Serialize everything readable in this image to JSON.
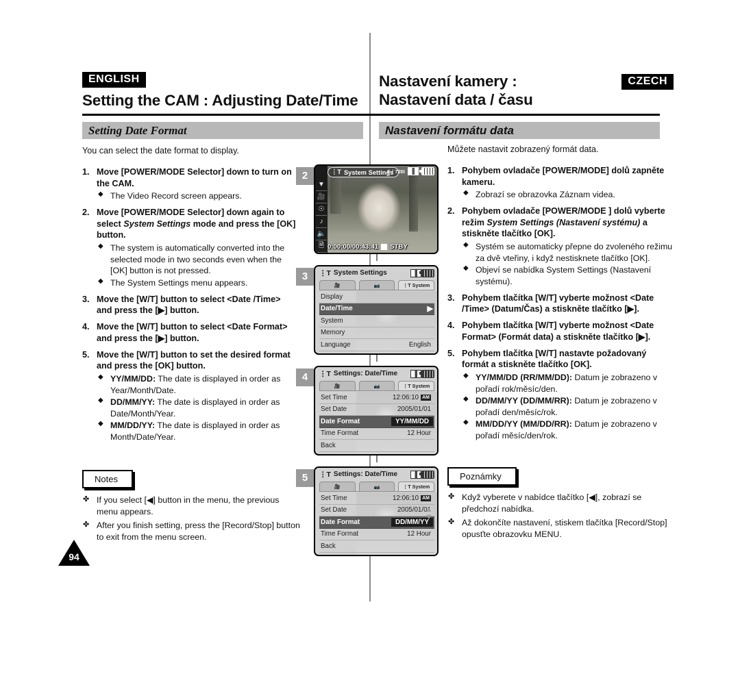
{
  "header": {
    "english_tag": "ENGLISH",
    "english_title": "Setting the CAM : Adjusting Date/Time",
    "czech_tag": "CZECH",
    "czech_title_line1": "Nastavení kamery :",
    "czech_title_line2": "Nastavení data / času"
  },
  "section": {
    "english": "Setting Date Format",
    "czech": "Nastavení formátu data"
  },
  "english": {
    "intro": "You can select the date format to display.",
    "steps": [
      {
        "num": "1.",
        "text_parts": [
          {
            "t": "Move [POWER/MODE Selector] down to turn on the CAM.",
            "style": "bold"
          }
        ],
        "bullets": [
          {
            "text": "The Video Record screen appears."
          }
        ]
      },
      {
        "num": "2.",
        "text_parts": [
          {
            "t": "Move [POWER/MODE Selector] down again to select ",
            "style": "bold"
          },
          {
            "t": "System Settings",
            "style": "bold-italic"
          },
          {
            "t": " mode and press the [OK] button.",
            "style": "bold"
          }
        ],
        "bullets": [
          {
            "text": "The system is automatically converted into the selected mode in two seconds even when the [OK] button is not pressed."
          },
          {
            "text": "The System Settings menu appears."
          }
        ]
      },
      {
        "num": "3.",
        "text_parts": [
          {
            "t": "Move the [W/T] button to select <Date /Time> and press the [▶] button.",
            "style": "bold"
          }
        ],
        "bullets": []
      },
      {
        "num": "4.",
        "text_parts": [
          {
            "t": "Move the [W/T] button to select <Date Format> and press the [▶] button.",
            "style": "bold"
          }
        ],
        "bullets": []
      },
      {
        "num": "5.",
        "text_parts": [
          {
            "t": "Move the [W/T] button to set the desired format and press the [OK] button.",
            "style": "bold"
          }
        ],
        "bullets": [
          {
            "lead": "YY/MM/DD:",
            "text": " The date is displayed in order as Year/Month/Date."
          },
          {
            "lead": "DD/MM/YY:",
            "text": " The date is displayed in order as Date/Month/Year."
          },
          {
            "lead": "MM/DD/YY:",
            "text": " The date is displayed in order as Month/Date/Year."
          }
        ]
      }
    ],
    "notes_label": "Notes",
    "notes": [
      "If you select [◀] button in the menu, the previous menu appears.",
      "After you finish setting, press the [Record/Stop] button to exit from the menu screen."
    ]
  },
  "czech": {
    "intro": "Můžete nastavit zobrazený formát data.",
    "steps": [
      {
        "num": "1.",
        "text_parts": [
          {
            "t": "Pohybem ovladače [POWER/MODE] dolů zapněte kameru.",
            "style": "bold"
          }
        ],
        "bullets": [
          {
            "text": "Zobrazí se obrazovka Záznam videa."
          }
        ]
      },
      {
        "num": "2.",
        "text_parts": [
          {
            "t": "Pohybem ovladače [POWER/MODE ] dolů vyberte režim ",
            "style": "bold"
          },
          {
            "t": "System Settings (Nastavení systému)",
            "style": "bold-italic"
          },
          {
            "t": " a stiskněte tlačítko [OK].",
            "style": "bold"
          }
        ],
        "bullets": [
          {
            "text": "Systém se automaticky přepne do zvoleného režimu za dvě vteřiny, i když nestisknete tlačítko [OK]."
          },
          {
            "text": "Objeví se nabídka System Settings (Nastavení systému)."
          }
        ]
      },
      {
        "num": "3.",
        "text_parts": [
          {
            "t": "Pohybem tlačítka [W/T] vyberte možnost <Date /Time> (Datum/Čas) a stiskněte tlačítko [▶].",
            "style": "bold"
          }
        ],
        "bullets": []
      },
      {
        "num": "4.",
        "text_parts": [
          {
            "t": "Pohybem tlačítka [W/T] vyberte možnost <Date Format> (Formát data) a stiskněte tlačítko [▶].",
            "style": "bold"
          }
        ],
        "bullets": []
      },
      {
        "num": "5.",
        "text_parts": [
          {
            "t": "Pohybem tlačítka [W/T] nastavte požadovaný formát a stiskněte tlačítko [OK].",
            "style": "bold"
          }
        ],
        "bullets": [
          {
            "lead": "YY/MM/DD (RR/MM/DD):",
            "text": " Datum je zobrazeno v pořadí rok/měsíc/den."
          },
          {
            "lead": "DD/MM/YY (DD/MM/RR):",
            "text": " Datum je zobrazeno v pořadí den/měsíc/rok."
          },
          {
            "lead": "MM/DD/YY (MM/DD/RR):",
            "text": " Datum je zobrazeno v pořadí měsíc/den/rok."
          }
        ]
      }
    ],
    "notes_label": "Poznámky",
    "notes": [
      "Když vyberete v nabídce tlačítko [◀], zobrazí se předchozí nabídka.",
      "Až dokončíte nastavení, stiskem tlačítka [Record/Stop] opusťte obrazovku MENU."
    ]
  },
  "screens": {
    "shot1": {
      "badge": "2",
      "osd_mode_label": "System Settings",
      "format_label": "F / 720i",
      "timecode": "0:00:00/00:43:41",
      "status": "STBY",
      "side_icons": [
        "chevron-down-icon",
        "video-camera-icon",
        "photo-camera-icon",
        "music-note-icon",
        "microphone-icon",
        "document-icon"
      ]
    },
    "shot2": {
      "badge": "3",
      "title": "System Settings",
      "tabs": [
        {
          "label": "🎥",
          "name": "video-tab",
          "active": false
        },
        {
          "label": "📷",
          "name": "photo-tab",
          "active": false
        },
        {
          "label": "System",
          "name": "system-tab",
          "active": true
        }
      ],
      "rows": [
        {
          "label": "Display",
          "value": "",
          "selected": false
        },
        {
          "label": "Date/Time",
          "value": "",
          "selected": true
        },
        {
          "label": "System",
          "value": "",
          "selected": false
        },
        {
          "label": "Memory",
          "value": "",
          "selected": false
        },
        {
          "label": "Language",
          "value": "English",
          "selected": false
        }
      ]
    },
    "shot3": {
      "badge": "4",
      "title": "Settings: Date/Time",
      "tabs": [
        {
          "label": "🎥",
          "name": "video-tab",
          "active": false
        },
        {
          "label": "📷",
          "name": "photo-tab",
          "active": false
        },
        {
          "label": "System",
          "name": "system-tab",
          "active": true
        }
      ],
      "rows": [
        {
          "label": "Set Time",
          "value": "12:06:10",
          "ampm": "AM",
          "selected": false
        },
        {
          "label": "Set Date",
          "value": "2005/01/01",
          "selected": false
        },
        {
          "label": "Date Format",
          "value": "YY/MM/DD",
          "selected": true,
          "highlight": true
        },
        {
          "label": "Time Format",
          "value": "12 Hour",
          "selected": false
        },
        {
          "label": "Back",
          "value": "",
          "selected": false
        }
      ]
    },
    "shot4": {
      "badge": "5",
      "title": "Settings: Date/Time",
      "tabs": [
        {
          "label": "🎥",
          "name": "video-tab",
          "active": false
        },
        {
          "label": "📷",
          "name": "photo-tab",
          "active": false
        },
        {
          "label": "System",
          "name": "system-tab",
          "active": true
        }
      ],
      "rows": [
        {
          "label": "Set Time",
          "value": "12:06:10",
          "ampm": "AM",
          "selected": false
        },
        {
          "label": "Set Date",
          "value": "2005/01/01",
          "selected": false
        },
        {
          "label": "Date Format",
          "value": "DD/MM/YY",
          "selected": true,
          "highlight": true
        },
        {
          "label": "Time Format",
          "value": "12 Hour",
          "selected": false
        },
        {
          "label": "Back",
          "value": "",
          "selected": false
        }
      ]
    }
  },
  "page_number": "94"
}
